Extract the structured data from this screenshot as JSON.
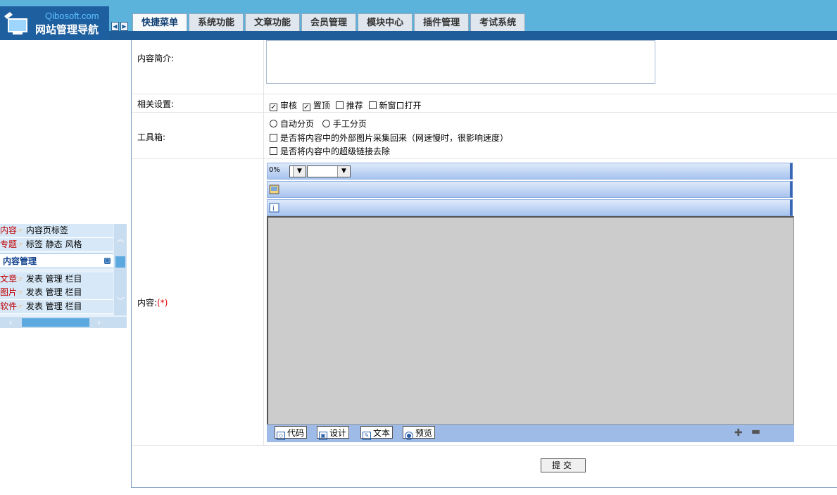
{
  "logo": {
    "brand": "Qibosoft.com",
    "title": "网站管理导航"
  },
  "nav_arrows": {
    "left": "◀",
    "right": "▶"
  },
  "tabs": [
    {
      "label": "快捷菜单",
      "active": true
    },
    {
      "label": "系统功能"
    },
    {
      "label": "文章功能"
    },
    {
      "label": "会员管理"
    },
    {
      "label": "模块中心"
    },
    {
      "label": "插件管理"
    },
    {
      "label": "考试系统"
    }
  ],
  "sidebar": {
    "rows_top": [
      {
        "key": "内容",
        "links": "内容页标签"
      },
      {
        "key": "专题",
        "links": "标签 静态 风格"
      }
    ],
    "section_title": "内容管理",
    "rows_bottom": [
      {
        "key": "文章",
        "links": "发表 管理 栏目"
      },
      {
        "key": "图片",
        "links": "发表 管理 栏目"
      },
      {
        "key": "软件",
        "links": "发表 管理 栏目"
      }
    ]
  },
  "form": {
    "intro_label": "内容简介:",
    "settings_label": "相关设置:",
    "settings": [
      {
        "label": "审核",
        "checked": true
      },
      {
        "label": "置顶",
        "checked": true
      },
      {
        "label": "推荐",
        "checked": false
      },
      {
        "label": "新窗口打开",
        "checked": false
      }
    ],
    "toolbox_label": "工具箱:",
    "paging": [
      "自动分页",
      "手工分页"
    ],
    "toolbox_options": [
      "是否将内容中的外部图片采集回来（网速慢时，很影响速度）",
      "是否将内容中的超级链接去除"
    ],
    "content_label": "内容:",
    "required_mark": "(*)",
    "zoom_value": "0%",
    "submit_label": "提交"
  },
  "editor_modes": [
    {
      "label": "代码",
      "icon": "code-icon"
    },
    {
      "label": "设计",
      "icon": "design-icon"
    },
    {
      "label": "文本",
      "icon": "text-icon"
    },
    {
      "label": "预览",
      "icon": "preview-icon"
    }
  ],
  "colors": {
    "topbar": "#5bb2db",
    "navy": "#1f5d9a",
    "sidebar_key": "#c00000"
  }
}
